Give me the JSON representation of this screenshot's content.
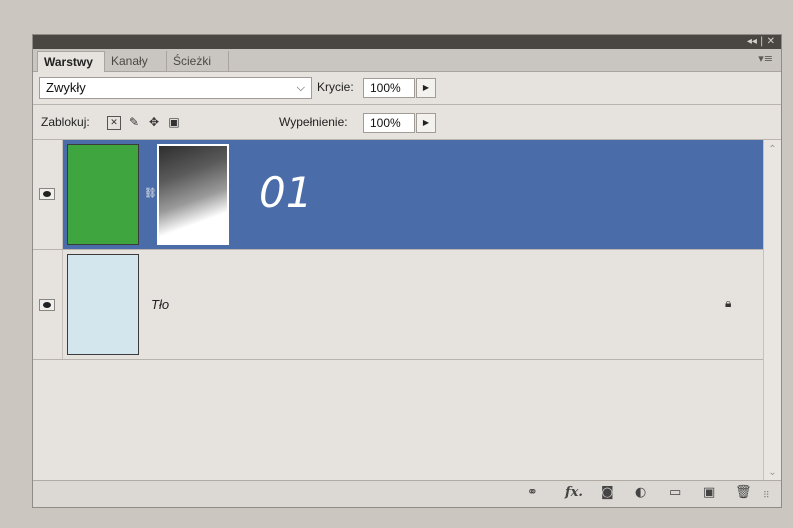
{
  "panel": {
    "window_buttons": "◂◂ | ✕",
    "menu_icon": "▾≡"
  },
  "tabs": [
    "Warstwy",
    "Kanały",
    "Ścieżki"
  ],
  "blend": {
    "mode": "Zwykły",
    "chevron": "⌵"
  },
  "opacity": {
    "label": "Krycie:",
    "value": "100%"
  },
  "lock": {
    "label": "Zablokuj:",
    "icons": [
      "lock-transparent-icon",
      "lock-brush-icon",
      "lock-move-icon",
      "lock-all-icon"
    ]
  },
  "fill": {
    "label": "Wypełnienie:",
    "value": "100%"
  },
  "layers": [
    {
      "name": "01",
      "selected": true,
      "color": "#3fa63f",
      "has_mask": true
    },
    {
      "name": "Tło",
      "selected": false,
      "color": "#d3e6ee",
      "locked": true
    }
  ],
  "colors": {
    "selected_row": "#4a6ca8",
    "panel_bg": "#e6e2de"
  },
  "bottom_icons": [
    "link-icon",
    "fx-icon",
    "mask-icon",
    "adjustment-icon",
    "folder-icon",
    "new-layer-icon",
    "trash-icon"
  ],
  "bottom_labels": {
    "fx": "fx."
  }
}
